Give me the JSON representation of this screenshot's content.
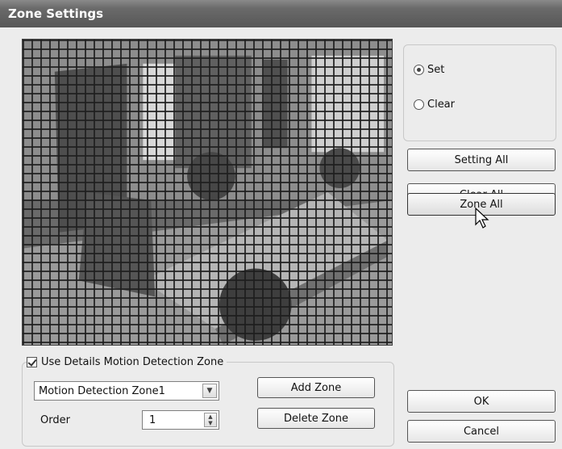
{
  "window": {
    "title": "Zone Settings"
  },
  "mode": {
    "options": [
      {
        "label": "Set",
        "checked": true
      },
      {
        "label": "Clear",
        "checked": false
      }
    ]
  },
  "actions": {
    "setting_all": "Setting All",
    "clear_all": "Clear All",
    "zone_all": "Zone All"
  },
  "detail": {
    "checkbox_label": "Use Details Motion Detection Zone",
    "checkbox_checked": true,
    "zone_select_value": "Motion Detection Zone1",
    "order_label": "Order",
    "order_value": "1",
    "add_zone": "Add Zone",
    "delete_zone": "Delete Zone"
  },
  "dialog": {
    "ok": "OK",
    "cancel": "Cancel"
  },
  "icons": {
    "cursor": "arrow-pointer-icon",
    "dropdown": "chevron-down-icon",
    "spinner": "spinner-arrows-icon"
  }
}
